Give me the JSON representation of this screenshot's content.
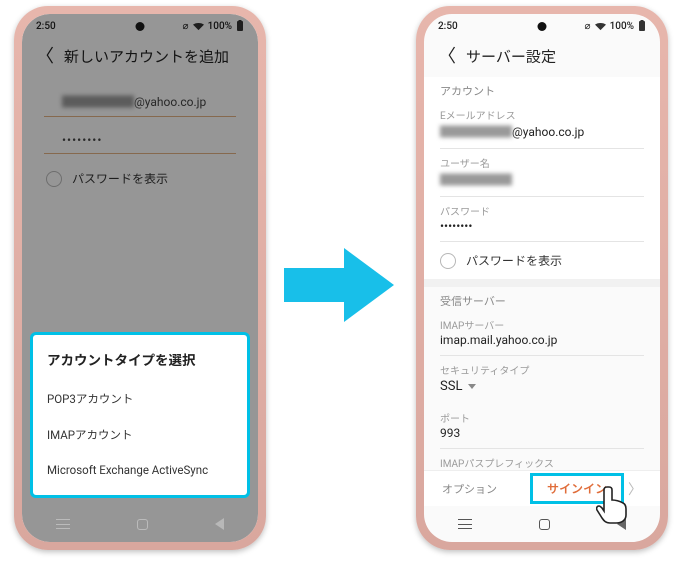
{
  "colors": {
    "accent": "#00c0e6",
    "action": "#e06d3a"
  },
  "status": {
    "time": "2:50",
    "battery": "100%",
    "wifi_icon": "wifi-icon",
    "signal_icon": "signal-icon"
  },
  "left": {
    "title": "新しいアカウントを追加",
    "email_mask": "██████",
    "email_suffix": "@yahoo.co.jp",
    "password_mask": "••••••••",
    "show_password_label": "パスワードを表示",
    "sheet": {
      "title": "アカウントタイプを選択",
      "options": [
        "POP3アカウント",
        "IMAPアカウント",
        "Microsoft Exchange ActiveSync"
      ]
    }
  },
  "right": {
    "title": "サーバー設定",
    "section_account": "アカウント",
    "labels": {
      "email": "Eメールアドレス",
      "username": "ユーザー名",
      "password": "パスワード",
      "incoming": "受信サーバー",
      "imap_server": "IMAPサーバー",
      "security": "セキュリティタイプ",
      "port": "ポート",
      "path_prefix": "IMAPパスプレフィックス"
    },
    "values": {
      "email_mask": "██████",
      "email_suffix": "@yahoo.co.jp",
      "username_mask": "██████",
      "password_mask": "••••••••",
      "imap_server": "imap.mail.yahoo.co.jp",
      "security": "SSL",
      "port": "993",
      "path_prefix": "オプション"
    },
    "show_password_label": "パスワードを表示",
    "signin_label": "サインイン"
  }
}
